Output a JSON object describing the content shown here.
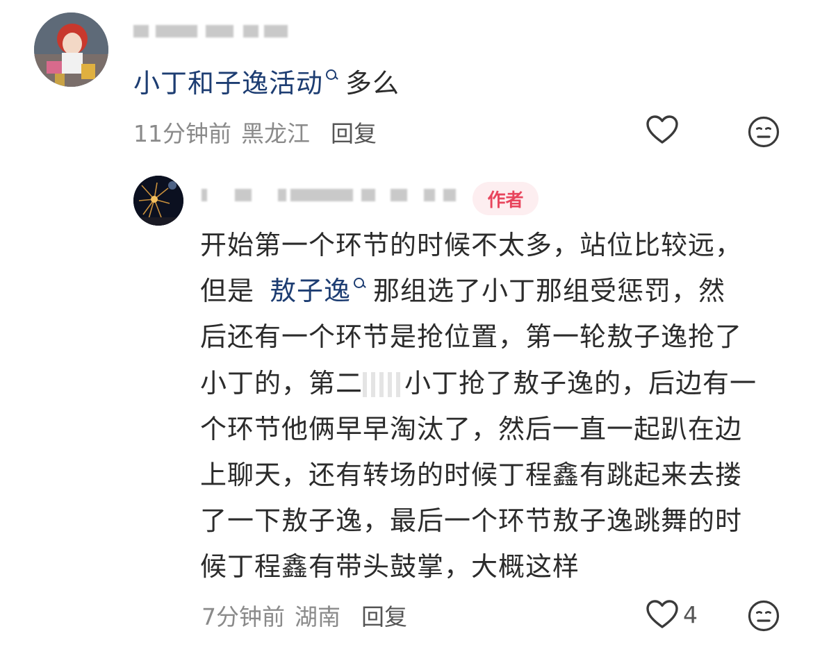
{
  "comments": [
    {
      "text_link": "小丁和子逸活动",
      "text_rest": "多么",
      "time": "11分钟前",
      "location": "黑龙江",
      "reply_label": "回复"
    },
    {
      "author_badge": "作者",
      "lines": [
        {
          "a": "开始第一个环节的时候不太多，站位比较远，",
          "link": "",
          "b": ""
        },
        {
          "a": "但是",
          "link": "敖子逸",
          "b": "那组选了小丁那组受惩罚，然"
        },
        {
          "a": "后还有一个环节是抢位置，第一轮敖子逸抢了",
          "link": "",
          "b": ""
        },
        {
          "a": "小丁的，第二",
          "link": "",
          "b": "小丁抢了敖子逸的，后边有一"
        },
        {
          "a": "个环节他俩早早淘汰了，然后一直一起趴在边",
          "link": "",
          "b": ""
        },
        {
          "a": "上聊天，还有转场的时候丁程鑫有跳起来去搂",
          "link": "",
          "b": ""
        },
        {
          "a": "了一下敖子逸，最后一个环节敖子逸跳舞的时",
          "link": "",
          "b": ""
        },
        {
          "a": "候丁程鑫有带头鼓掌，大概这样",
          "link": "",
          "b": ""
        }
      ],
      "time": "7分钟前",
      "location": "湖南",
      "reply_label": "回复",
      "like_count": "4"
    }
  ],
  "icons": {
    "like": "heart-outline-icon",
    "dislike": "meh-face-icon",
    "search_link": "search-icon"
  },
  "colors": {
    "link": "#1d3d72",
    "badge_text": "#e8455d",
    "badge_bg": "#fdeef0",
    "meta": "#8a8a8a"
  }
}
